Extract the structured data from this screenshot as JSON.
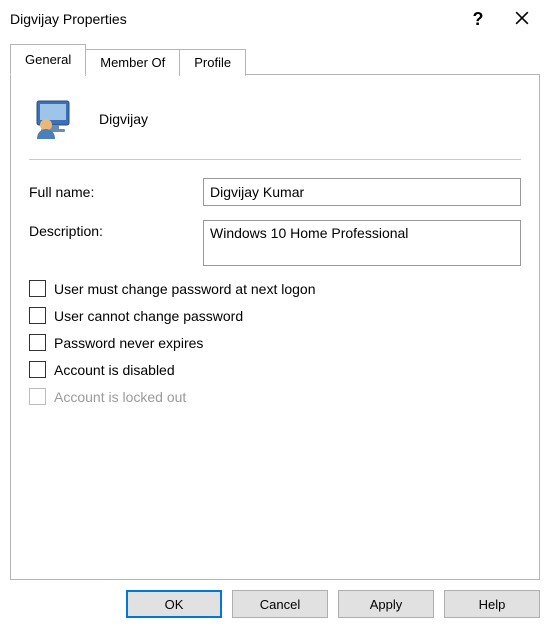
{
  "window": {
    "title": "Digvijay Properties"
  },
  "tabs": {
    "general": "General",
    "memberof": "Member Of",
    "profile": "Profile"
  },
  "general": {
    "username": "Digvijay",
    "fullname_label": "Full name:",
    "fullname_value": "Digvijay Kumar",
    "description_label": "Description:",
    "description_value": "Windows 10 Home Professional",
    "checks": {
      "must_change": "User must change password at next logon",
      "cannot_change": "User cannot change password",
      "never_expires": "Password never expires",
      "disabled": "Account is disabled",
      "locked_out": "Account is locked out"
    }
  },
  "buttons": {
    "ok": "OK",
    "cancel": "Cancel",
    "apply": "Apply",
    "help": "Help"
  }
}
